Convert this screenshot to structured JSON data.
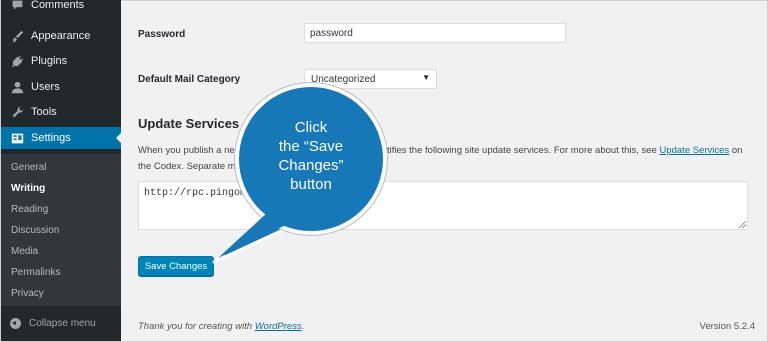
{
  "sidebar": {
    "items": [
      {
        "label": "Comments",
        "icon": "comments-icon"
      },
      {
        "label": "Appearance",
        "icon": "appearance-icon"
      },
      {
        "label": "Plugins",
        "icon": "plugins-icon"
      },
      {
        "label": "Users",
        "icon": "users-icon"
      },
      {
        "label": "Tools",
        "icon": "tools-icon"
      },
      {
        "label": "Settings",
        "icon": "settings-icon",
        "active": true
      }
    ],
    "submenu": [
      "General",
      "Writing",
      "Reading",
      "Discussion",
      "Media",
      "Permalinks",
      "Privacy"
    ],
    "submenu_current": "Writing",
    "collapse_label": "Collapse menu"
  },
  "form": {
    "password_label": "Password",
    "password_value": "password",
    "mail_category_label": "Default Mail Category",
    "mail_category_value": "Uncategorized",
    "update_services_title": "Update Services",
    "desc_line1_a": "When you publish a ne",
    "desc_line1_b": "tifies the following site update services. For more about this, see",
    "desc_link": "Update Services",
    "desc_line1_c": "on",
    "desc_line2_a": "the Codex. Separate mu",
    "ping_value": "http://rpc.pingoma",
    "save_label": "Save Changes"
  },
  "callout": {
    "line1": "Click",
    "line2": "the “Save",
    "line3": "Changes”",
    "line4": "button"
  },
  "footer": {
    "thanks_prefix": "Thank you for creating with",
    "thanks_link": "WordPress",
    "thanks_suffix": ".",
    "version": "Version 5.2.4"
  },
  "colors": {
    "sidebar_bg": "#23282d",
    "submenu_bg": "#32373c",
    "accent": "#0073aa",
    "button": "#0085ba",
    "callout": "#1778b8"
  }
}
